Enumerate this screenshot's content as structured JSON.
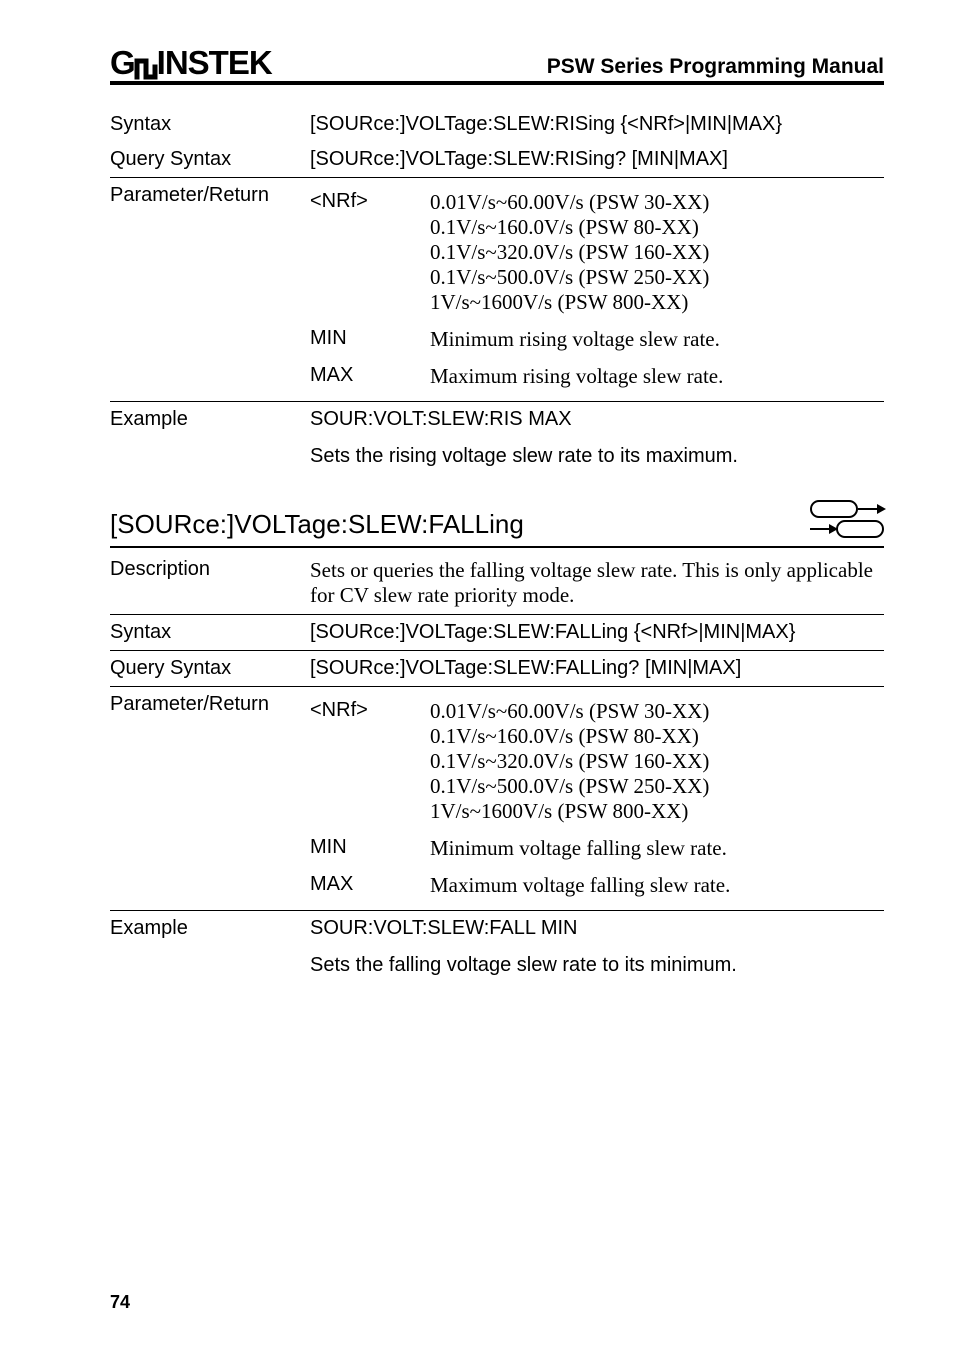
{
  "header": {
    "logo_left": "G",
    "logo_right": "INSTEK",
    "title": "PSW Series Programming Manual"
  },
  "section1": {
    "syntax_label": "Syntax",
    "syntax_value": "[SOURce:]VOLTage:SLEW:RISing {<NRf>|MIN|MAX}",
    "query_label": "Query Syntax",
    "query_value": "[SOURce:]VOLTage:SLEW:RISing? [MIN|MAX]",
    "param_label": "Parameter/Return",
    "params": [
      {
        "key": "<NRf>",
        "lines": [
          "0.01V/s~60.00V/s (PSW 30-XX)",
          "0.1V/s~160.0V/s (PSW 80-XX)",
          "0.1V/s~320.0V/s (PSW 160-XX)",
          "0.1V/s~500.0V/s (PSW 250-XX)",
          "1V/s~1600V/s (PSW 800-XX)"
        ]
      },
      {
        "key": "MIN",
        "lines": [
          "Minimum rising voltage slew rate."
        ]
      },
      {
        "key": "MAX",
        "lines": [
          "Maximum rising voltage  slew rate."
        ]
      }
    ],
    "example_label": "Example",
    "example_value": "SOUR:VOLT:SLEW:RIS MAX",
    "example_note": "Sets the rising voltage slew rate to its maximum."
  },
  "section2": {
    "heading": "[SOURce:]VOLTage:SLEW:FALLing",
    "desc_label": "Description",
    "desc_value": "Sets or queries the falling voltage slew rate. This is only applicable for CV slew rate priority mode.",
    "syntax_label": "Syntax",
    "syntax_value": "[SOURce:]VOLTage:SLEW:FALLing {<NRf>|MIN|MAX}",
    "query_label": "Query Syntax",
    "query_value": "[SOURce:]VOLTage:SLEW:FALLing? [MIN|MAX]",
    "param_label": "Parameter/Return",
    "params": [
      {
        "key": "<NRf>",
        "lines": [
          "0.01V/s~60.00V/s (PSW 30-XX)",
          "0.1V/s~160.0V/s (PSW 80-XX)",
          "0.1V/s~320.0V/s (PSW 160-XX)",
          "0.1V/s~500.0V/s (PSW 250-XX)",
          "1V/s~1600V/s (PSW 800-XX)"
        ]
      },
      {
        "key": "MIN",
        "lines": [
          "Minimum voltage falling slew rate."
        ]
      },
      {
        "key": "MAX",
        "lines": [
          "Maximum voltage falling slew rate."
        ]
      }
    ],
    "example_label": "Example",
    "example_value": "SOUR:VOLT:SLEW:FALL MIN",
    "example_note": "Sets the falling voltage slew rate to its minimum."
  },
  "page_number": "74"
}
